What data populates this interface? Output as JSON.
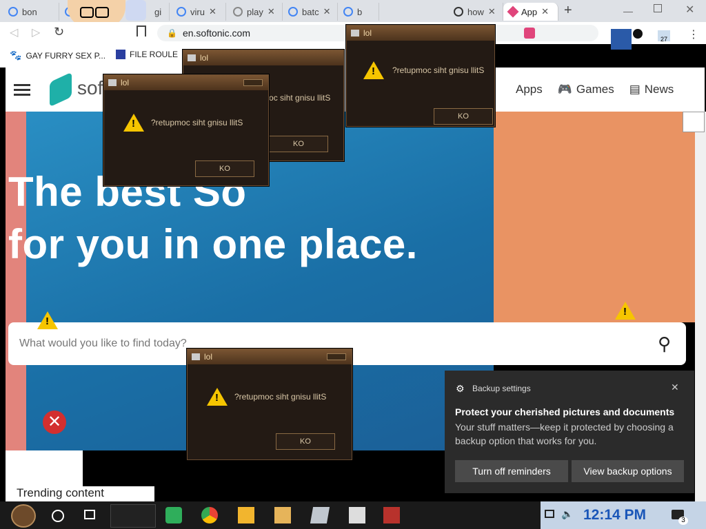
{
  "browser": {
    "tabs": [
      {
        "label": "bon"
      },
      {
        "label": "gi"
      },
      {
        "label": "viru"
      },
      {
        "label": "play"
      },
      {
        "label": "batc"
      },
      {
        "label": "b"
      },
      {
        "label": "how"
      },
      {
        "label": "App",
        "active": true
      }
    ],
    "new_tab": "+",
    "address": "en.softonic.com",
    "bookmarks": [
      {
        "label": "GAY FURRY SEX P..."
      },
      {
        "label": "FILE ROULE"
      }
    ],
    "badge_count": "27"
  },
  "site": {
    "logo": "softonic",
    "nav": [
      {
        "label": "Apps"
      },
      {
        "label": "Games"
      },
      {
        "label": "News"
      }
    ],
    "hero_line1": "The best So",
    "hero_line2": "for you in one place.",
    "search_placeholder": "What would you like to find today?",
    "trending": "Trending content"
  },
  "dialogs": [
    {
      "title": "lol",
      "message": "?retupmoc siht gnisu llitS",
      "ok": "KO"
    },
    {
      "title": "lol",
      "message": "?retupmoc siht gnisu llitS",
      "ok": "KO"
    },
    {
      "title": "lol",
      "message": "?retupmoc siht gnisu llitS",
      "ok": "KO"
    },
    {
      "title": "lol",
      "message": "?retupmoc siht gnisu llitS",
      "ok": "KO"
    }
  ],
  "toast": {
    "app": "Backup settings",
    "title": "Protect your cherished pictures and documents",
    "body": "Your stuff matters—keep it protected by choosing a backup option that works for you.",
    "btn_dismiss": "Turn off reminders",
    "btn_view": "View backup options"
  },
  "taskbar": {
    "time": "12:14 PM",
    "notification_count": "3"
  },
  "colors": {
    "hero_blue": "#1a6fa6",
    "orange": "#e99363",
    "softonic_accent": "#1fb0a8",
    "tray_bg": "#c5d4e6",
    "clock": "#1a56b8"
  }
}
